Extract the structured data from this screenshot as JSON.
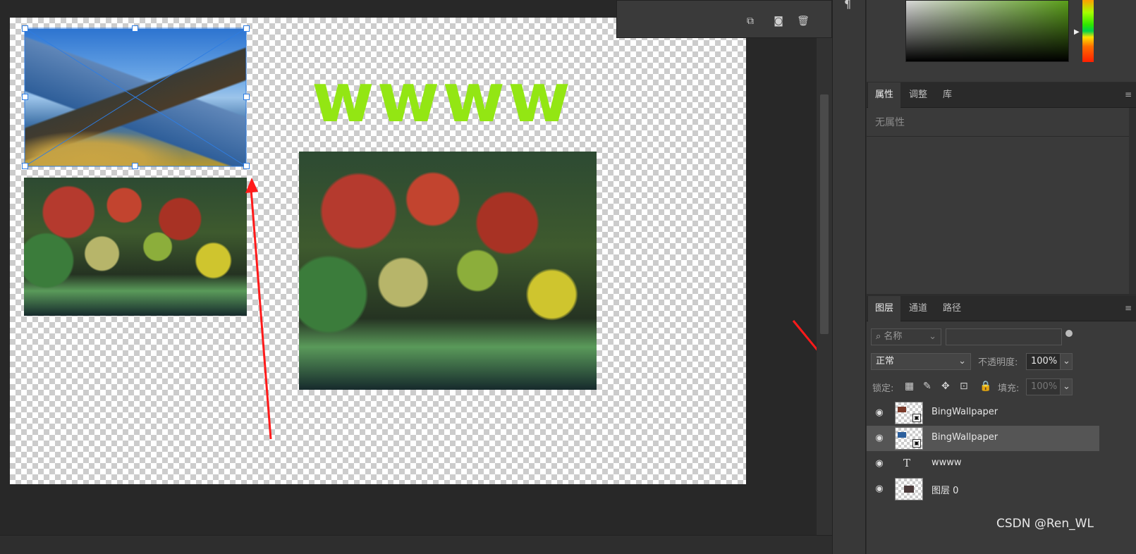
{
  "canvas": {
    "text_layer_content": "wwww",
    "text_color": "#93e613"
  },
  "history_panel": {
    "buttons": [
      "new-snapshot-icon",
      "camera-icon",
      "trash-icon"
    ]
  },
  "properties_panel": {
    "tabs": [
      {
        "label": "属性",
        "active": true
      },
      {
        "label": "调整",
        "active": false
      },
      {
        "label": "库",
        "active": false
      }
    ],
    "empty_text": "无属性"
  },
  "layers_panel": {
    "tabs": [
      {
        "label": "图层",
        "active": true
      },
      {
        "label": "通道",
        "active": false
      },
      {
        "label": "路径",
        "active": false
      }
    ],
    "filter_placeholder": "名称",
    "blend_mode": "正常",
    "opacity_label": "不透明度:",
    "opacity_value": "100%",
    "lock_label": "锁定:",
    "fill_label": "填充:",
    "fill_value": "100%",
    "layers": [
      {
        "name": "BingWallpaper",
        "kind": "smart-object",
        "visible": true,
        "selected": false
      },
      {
        "name": "BingWallpaper",
        "kind": "smart-object",
        "visible": true,
        "selected": true
      },
      {
        "name": "wwww",
        "kind": "text",
        "visible": true,
        "selected": false
      },
      {
        "name": "图层 0",
        "kind": "pixel",
        "visible": true,
        "selected": false
      }
    ]
  },
  "watermark": "CSDN @Ren_WL",
  "colors": {
    "accent_selection": "#2f7de1",
    "annotation_arrow": "#ff1a1a"
  }
}
